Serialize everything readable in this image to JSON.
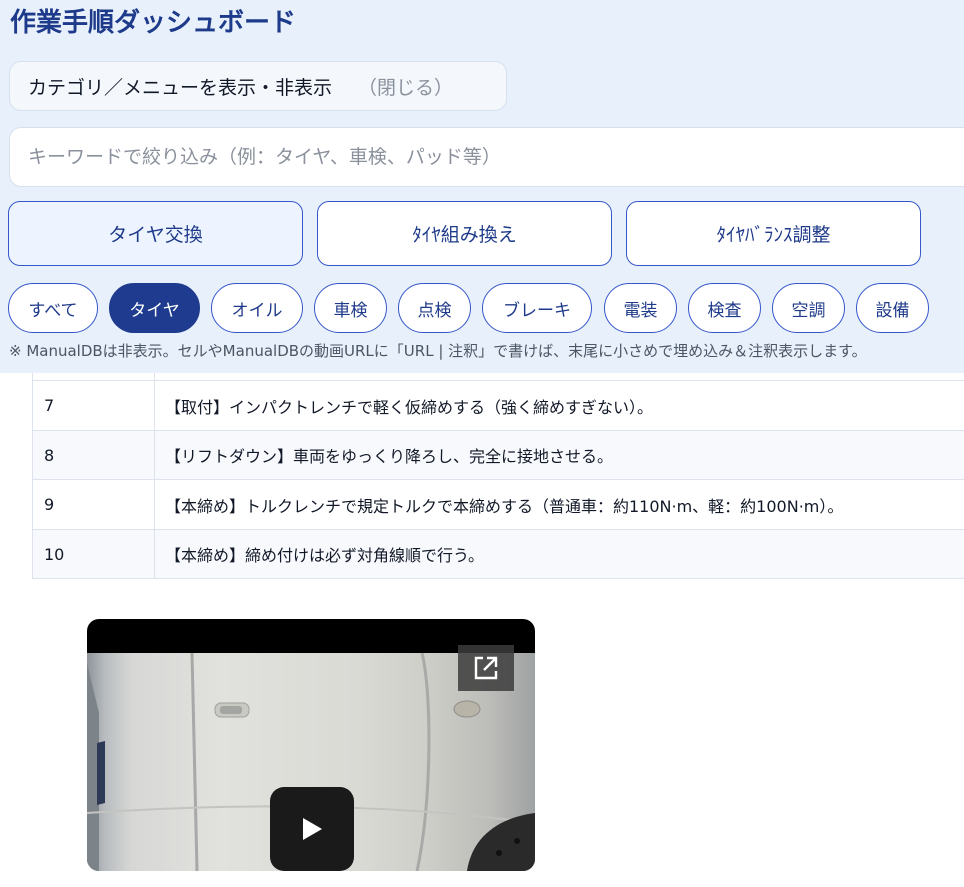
{
  "header": {
    "title": "作業手順ダッシュボード"
  },
  "toggle": {
    "label": "カテゴリ／メニューを表示・非表示",
    "state": "（閉じる）"
  },
  "search": {
    "placeholder": "キーワードで絞り込み（例：タイヤ、車検、パッド等）",
    "value": ""
  },
  "menu_buttons": [
    {
      "label": "タイヤ交換"
    },
    {
      "label": "ﾀｲﾔ組み換え"
    },
    {
      "label": "ﾀｲﾔﾊﾞﾗﾝｽ調整"
    }
  ],
  "categories": [
    {
      "label": "すべて"
    },
    {
      "label": "タイヤ",
      "active": true
    },
    {
      "label": "オイル"
    },
    {
      "label": "車検"
    },
    {
      "label": "点検"
    },
    {
      "label": "ブレーキ"
    },
    {
      "label": "電装"
    },
    {
      "label": "検査"
    },
    {
      "label": "空調"
    },
    {
      "label": "設備"
    }
  ],
  "note": "※ ManualDBは非表示。セルやManualDBの動画URLに「URL | 注釈」で書けば、末尾に小さめで埋め込み＆注釈表示します。",
  "steps": [
    {
      "num": "7",
      "text": "【取付】インパクトレンチで軽く仮締めする（強く締めすぎない）。"
    },
    {
      "num": "8",
      "text": "【リフトダウン】車両をゆっくり降ろし、完全に接地させる。"
    },
    {
      "num": "9",
      "text": "【本締め】トルクレンチで規定トルクで本締めする（普通車：約110N·m、軽：約100N·m）。"
    },
    {
      "num": "10",
      "text": "【本締め】締め付けは必ず対角線順で行う。"
    }
  ],
  "video": {
    "open_icon": "external-link-icon",
    "play_icon": "play-icon"
  },
  "colors": {
    "accent": "#1e3a8a",
    "active_chip": "#1f3b8f",
    "border": "#3557c9",
    "page_bg": "#e8f0fc"
  }
}
